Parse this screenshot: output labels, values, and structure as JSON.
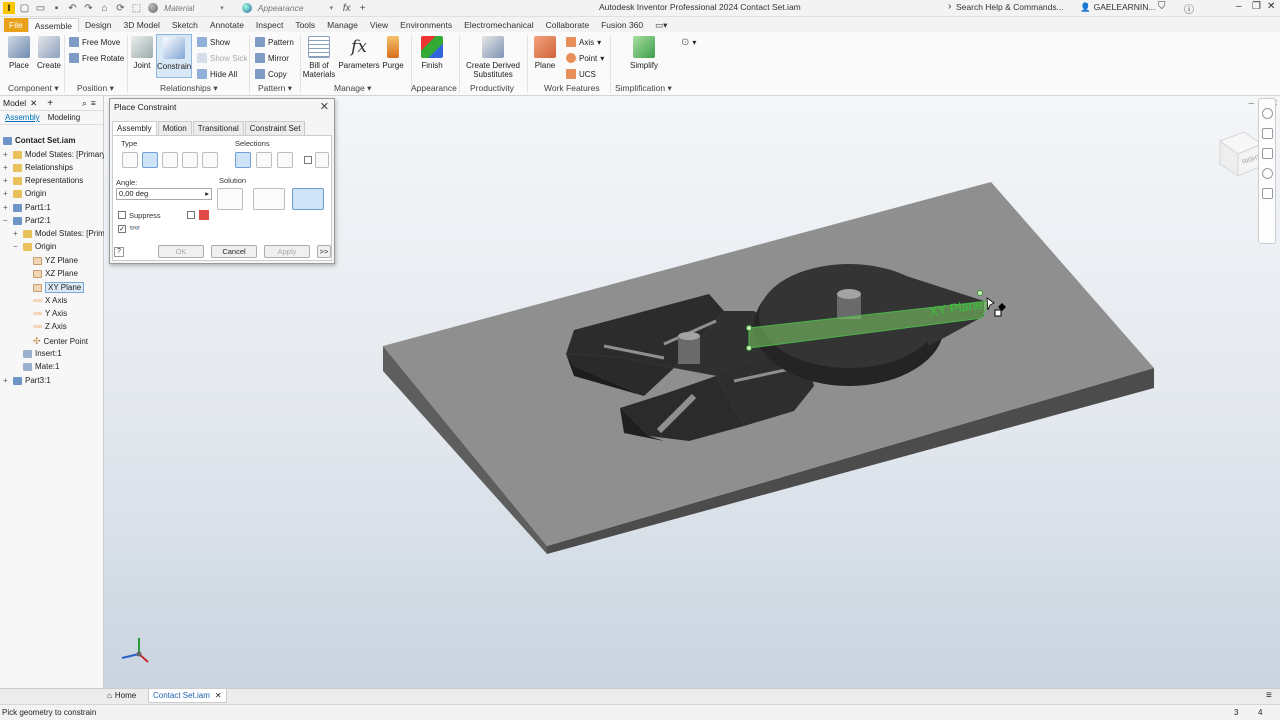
{
  "app": {
    "title": "Autodesk Inventor Professional 2024   Contact Set.iam",
    "logo_text": "I",
    "material_placeholder": "Material",
    "appearance_placeholder": "Appearance",
    "search_placeholder": "Search Help & Commands...",
    "user_name": "GAELEARNIN..."
  },
  "ribbon_tabs": [
    "File",
    "Assemble",
    "Design",
    "3D Model",
    "Sketch",
    "Annotate",
    "Inspect",
    "Tools",
    "Manage",
    "View",
    "Environments",
    "Electromechanical",
    "Collaborate",
    "Fusion 360"
  ],
  "ribbon": {
    "place": "Place",
    "create": "Create",
    "free_move": "Free Move",
    "free_rotate": "Free Rotate",
    "joint": "Joint",
    "constrain": "Constrain",
    "show": "Show",
    "show_sick": "Show Sick",
    "hide_all": "Hide All",
    "pattern": "Pattern",
    "mirror": "Mirror",
    "copy": "Copy",
    "bill_of_materials_1": "Bill of",
    "bill_of_materials_2": "Materials",
    "parameters": "Parameters",
    "purge": "Purge",
    "finish": "Finish",
    "create_derived_1": "Create Derived",
    "create_derived_2": "Substitutes",
    "plane": "Plane",
    "axis": "Axis",
    "point": "Point",
    "ucs": "UCS",
    "simplify": "Simplify",
    "panels": {
      "component": "Component",
      "position": "Position",
      "relationships": "Relationships",
      "pattern": "Pattern",
      "manage": "Manage",
      "appearance": "Appearance",
      "productivity": "Productivity",
      "work_features": "Work Features",
      "simplification": "Simplification"
    }
  },
  "browser": {
    "title": "Model",
    "tab_assembly": "Assembly",
    "tab_modeling": "Modeling",
    "root": "Contact Set.iam",
    "nodes": {
      "model_states": "Model States: [Primary]",
      "relationships": "Relationships",
      "representations": "Representations",
      "origin": "Origin",
      "part1": "Part1:1",
      "part2": "Part2:1",
      "p2_model_states": "Model States: [Primar",
      "p2_origin": "Origin",
      "yz_plane": "YZ Plane",
      "xz_plane": "XZ Plane",
      "xy_plane": "XY Plane",
      "x_axis": "X Axis",
      "y_axis": "Y Axis",
      "z_axis": "Z Axis",
      "center_point": "Center Point",
      "insert": "Insert:1",
      "mate": "Mate:1",
      "part3": "Part3:1"
    }
  },
  "dialog": {
    "title": "Place Constraint",
    "tabs": [
      "Assembly",
      "Motion",
      "Transitional",
      "Constraint Set"
    ],
    "type_label": "Type",
    "selections_label": "Selections",
    "angle_label": "Angle:",
    "angle_value": "0,00 deg",
    "solution_label": "Solution",
    "suppress_label": "Suppress",
    "ok": "OK",
    "cancel": "Cancel",
    "apply": "Apply",
    "more": ">>"
  },
  "viewport": {
    "plane_label": "XY Plane",
    "viewcube_face": "RIGHT"
  },
  "doc_tabs": {
    "home": "Home",
    "active_doc": "Contact Set.iam"
  },
  "status": {
    "prompt": "Pick geometry to constrain",
    "count_a": "3",
    "count_b": "4"
  },
  "colors": {
    "file_tab": "#e8a118",
    "selection_green": "#8ed16b",
    "part_dark": "#2f2f2f",
    "base_plate": "#8a8a8a"
  }
}
